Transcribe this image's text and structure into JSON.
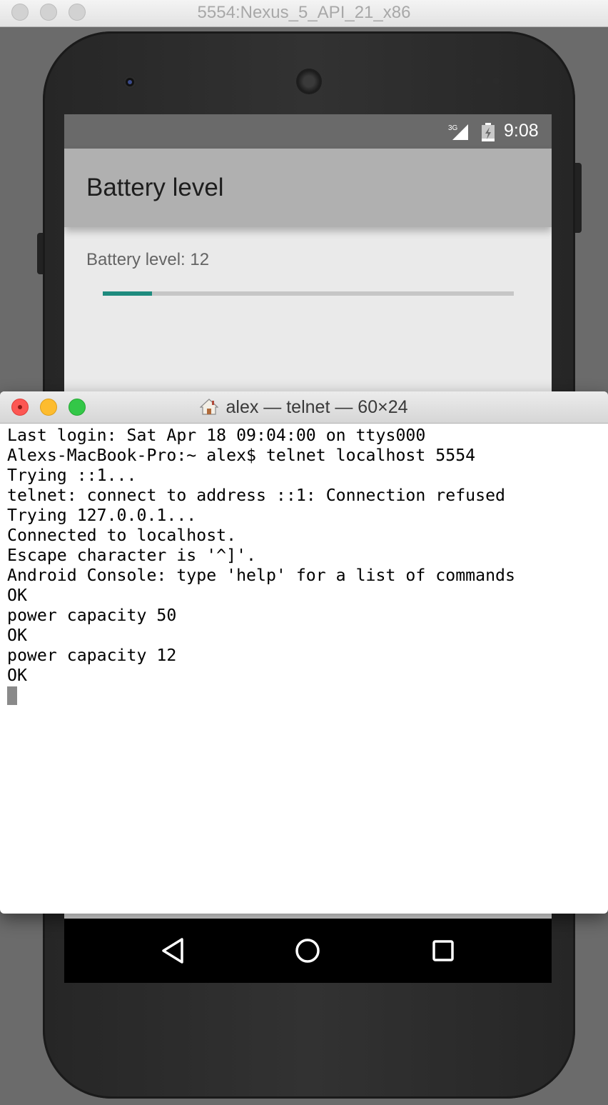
{
  "emulator": {
    "title": "5554:Nexus_5_API_21_x86",
    "status_bar": {
      "network": "3G",
      "time": "9:08"
    },
    "app": {
      "title": "Battery level",
      "battery_label": "Battery level: 12",
      "battery_progress_percent": 12
    },
    "nav": [
      "back",
      "home",
      "recents"
    ]
  },
  "terminal": {
    "title": "alex — telnet — 60×24",
    "lines": [
      "Last login: Sat Apr 18 09:04:00 on ttys000",
      "Alexs-MacBook-Pro:~ alex$ telnet localhost 5554",
      "Trying ::1...",
      "telnet: connect to address ::1: Connection refused",
      "Trying 127.0.0.1...",
      "Connected to localhost.",
      "Escape character is '^]'.",
      "Android Console: type 'help' for a list of commands",
      "OK",
      "power capacity 50",
      "OK",
      "power capacity 12",
      "OK"
    ]
  },
  "colors": {
    "progress_fill": "#1e8b7e",
    "close_light": "#fc5753",
    "minimize_light": "#fdbc2f",
    "zoom_light": "#33c748"
  }
}
